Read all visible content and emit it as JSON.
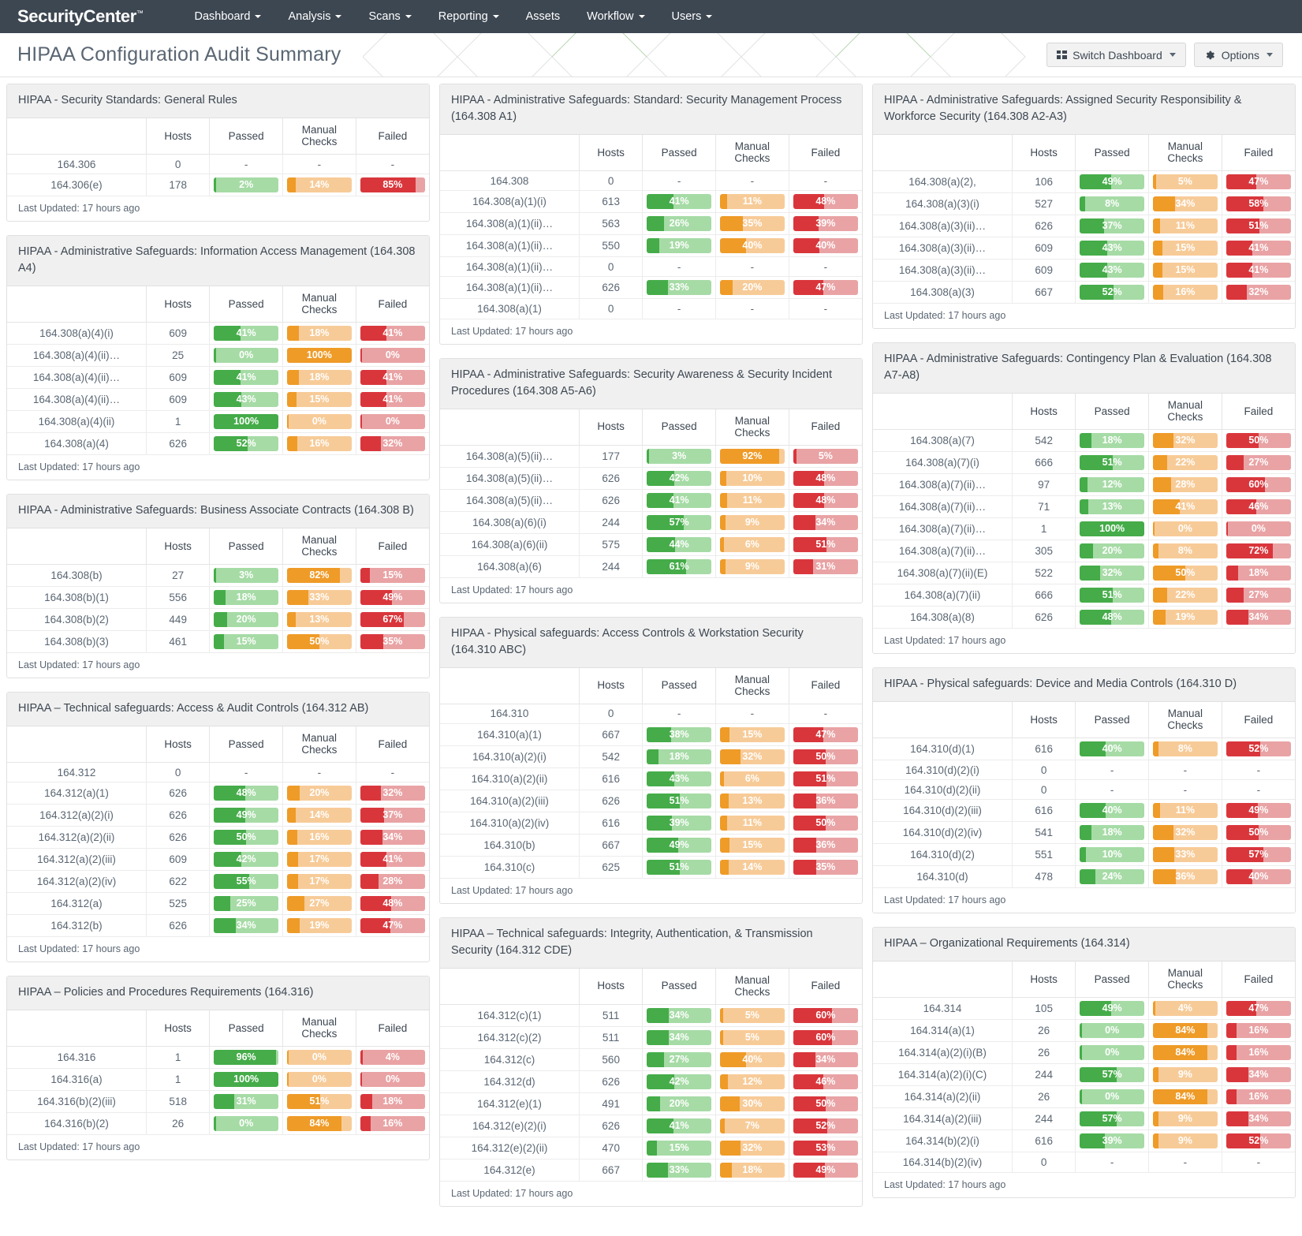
{
  "nav": {
    "brand": "SecurityCenter",
    "brand_tm": "™",
    "items": [
      {
        "label": "Dashboard",
        "caret": true
      },
      {
        "label": "Analysis",
        "caret": true
      },
      {
        "label": "Scans",
        "caret": true
      },
      {
        "label": "Reporting",
        "caret": true
      },
      {
        "label": "Assets",
        "caret": false
      },
      {
        "label": "Workflow",
        "caret": true
      },
      {
        "label": "Users",
        "caret": true
      }
    ]
  },
  "header": {
    "title": "HIPAA Configuration Audit Summary",
    "switch_dashboard": "Switch Dashboard",
    "options": "Options"
  },
  "colors": {
    "pass_fill": "#45ac49",
    "pass_track": "#a6dba6",
    "manual_fill": "#ef9b28",
    "manual_track": "#f7cb98",
    "fail_fill": "#d9363c",
    "fail_track": "#e9a3a5",
    "navbar": "#3d4752",
    "panel_head": "#f0f0f0"
  },
  "table_headers": [
    "",
    "Hosts",
    "Passed",
    "Manual Checks",
    "Failed"
  ],
  "last_updated": "Last Updated: 17 hours ago",
  "dash": "-",
  "columns": [
    {
      "panels": [
        {
          "title": "HIPAA - Security Standards: General Rules",
          "rows": [
            {
              "name": "164.306",
              "hosts": "0",
              "passed": null,
              "manual": null,
              "failed": null
            },
            {
              "name": "164.306(e)",
              "hosts": "178",
              "passed": "2%",
              "manual": "14%",
              "failed": "85%"
            }
          ]
        },
        {
          "title": "HIPAA - Administrative Safeguards: Information Access Management (164.308 A4)",
          "rows": [
            {
              "name": "164.308(a)(4)(i)",
              "hosts": "609",
              "passed": "41%",
              "manual": "18%",
              "failed": "41%"
            },
            {
              "name": "164.308(a)(4)(ii)…",
              "hosts": "25",
              "passed": "0%",
              "manual": "100%",
              "failed": "0%"
            },
            {
              "name": "164.308(a)(4)(ii)…",
              "hosts": "609",
              "passed": "41%",
              "manual": "18%",
              "failed": "41%"
            },
            {
              "name": "164.308(a)(4)(ii)…",
              "hosts": "609",
              "passed": "43%",
              "manual": "15%",
              "failed": "41%"
            },
            {
              "name": "164.308(a)(4)(ii)",
              "hosts": "1",
              "passed": "100%",
              "manual": "0%",
              "failed": "0%"
            },
            {
              "name": "164.308(a)(4)",
              "hosts": "626",
              "passed": "52%",
              "manual": "16%",
              "failed": "32%"
            }
          ]
        },
        {
          "title": "HIPAA - Administrative Safeguards: Business Associate Contracts (164.308 B)",
          "rows": [
            {
              "name": "164.308(b)",
              "hosts": "27",
              "passed": "3%",
              "manual": "82%",
              "failed": "15%"
            },
            {
              "name": "164.308(b)(1)",
              "hosts": "556",
              "passed": "18%",
              "manual": "33%",
              "failed": "49%"
            },
            {
              "name": "164.308(b)(2)",
              "hosts": "449",
              "passed": "20%",
              "manual": "13%",
              "failed": "67%"
            },
            {
              "name": "164.308(b)(3)",
              "hosts": "461",
              "passed": "15%",
              "manual": "50%",
              "failed": "35%"
            }
          ]
        },
        {
          "title": "HIPAA – Technical safeguards: Access & Audit Controls (164.312 AB)",
          "rows": [
            {
              "name": "164.312",
              "hosts": "0",
              "passed": null,
              "manual": null,
              "failed": null
            },
            {
              "name": "164.312(a)(1)",
              "hosts": "626",
              "passed": "48%",
              "manual": "20%",
              "failed": "32%"
            },
            {
              "name": "164.312(a)(2)(i)",
              "hosts": "626",
              "passed": "49%",
              "manual": "14%",
              "failed": "37%"
            },
            {
              "name": "164.312(a)(2)(ii)",
              "hosts": "626",
              "passed": "50%",
              "manual": "16%",
              "failed": "34%"
            },
            {
              "name": "164.312(a)(2)(iii)",
              "hosts": "609",
              "passed": "42%",
              "manual": "17%",
              "failed": "41%"
            },
            {
              "name": "164.312(a)(2)(iv)",
              "hosts": "622",
              "passed": "55%",
              "manual": "17%",
              "failed": "28%"
            },
            {
              "name": "164.312(a)",
              "hosts": "525",
              "passed": "25%",
              "manual": "27%",
              "failed": "48%"
            },
            {
              "name": "164.312(b)",
              "hosts": "626",
              "passed": "34%",
              "manual": "19%",
              "failed": "47%"
            }
          ]
        },
        {
          "title": "HIPAA – Policies and Procedures Requirements (164.316)",
          "rows": [
            {
              "name": "164.316",
              "hosts": "1",
              "passed": "96%",
              "manual": "0%",
              "failed": "4%"
            },
            {
              "name": "164.316(a)",
              "hosts": "1",
              "passed": "100%",
              "manual": "0%",
              "failed": "0%"
            },
            {
              "name": "164.316(b)(2)(iii)",
              "hosts": "518",
              "passed": "31%",
              "manual": "51%",
              "failed": "18%"
            },
            {
              "name": "164.316(b)(2)",
              "hosts": "26",
              "passed": "0%",
              "manual": "84%",
              "failed": "16%"
            }
          ]
        }
      ]
    },
    {
      "panels": [
        {
          "title": "HIPAA - Administrative Safeguards: Standard: Security Management Process (164.308 A1)",
          "rows": [
            {
              "name": "164.308",
              "hosts": "0",
              "passed": null,
              "manual": null,
              "failed": null
            },
            {
              "name": "164.308(a)(1)(i)",
              "hosts": "613",
              "passed": "41%",
              "manual": "11%",
              "failed": "48%"
            },
            {
              "name": "164.308(a)(1)(ii)…",
              "hosts": "563",
              "passed": "26%",
              "manual": "35%",
              "failed": "39%"
            },
            {
              "name": "164.308(a)(1)(ii)…",
              "hosts": "550",
              "passed": "19%",
              "manual": "40%",
              "failed": "40%"
            },
            {
              "name": "164.308(a)(1)(ii)…",
              "hosts": "0",
              "passed": null,
              "manual": null,
              "failed": null
            },
            {
              "name": "164.308(a)(1)(ii)…",
              "hosts": "626",
              "passed": "33%",
              "manual": "20%",
              "failed": "47%"
            },
            {
              "name": "164.308(a)(1)",
              "hosts": "0",
              "passed": null,
              "manual": null,
              "failed": null
            }
          ]
        },
        {
          "title": "HIPAA - Administrative Safeguards: Security Awareness & Security Incident Procedures (164.308 A5-A6)",
          "rows": [
            {
              "name": "164.308(a)(5)(ii)…",
              "hosts": "177",
              "passed": "3%",
              "manual": "92%",
              "failed": "5%"
            },
            {
              "name": "164.308(a)(5)(ii)…",
              "hosts": "626",
              "passed": "42%",
              "manual": "10%",
              "failed": "48%"
            },
            {
              "name": "164.308(a)(5)(ii)…",
              "hosts": "626",
              "passed": "41%",
              "manual": "11%",
              "failed": "48%"
            },
            {
              "name": "164.308(a)(6)(i)",
              "hosts": "244",
              "passed": "57%",
              "manual": "9%",
              "failed": "34%"
            },
            {
              "name": "164.308(a)(6)(ii)",
              "hosts": "575",
              "passed": "44%",
              "manual": "6%",
              "failed": "51%"
            },
            {
              "name": "164.308(a)(6)",
              "hosts": "244",
              "passed": "61%",
              "manual": "9%",
              "failed": "31%"
            }
          ]
        },
        {
          "title": "HIPAA - Physical safeguards: Access Controls & Workstation Security (164.310 ABC)",
          "rows": [
            {
              "name": "164.310",
              "hosts": "0",
              "passed": null,
              "manual": null,
              "failed": null
            },
            {
              "name": "164.310(a)(1)",
              "hosts": "667",
              "passed": "38%",
              "manual": "15%",
              "failed": "47%"
            },
            {
              "name": "164.310(a)(2)(i)",
              "hosts": "542",
              "passed": "18%",
              "manual": "32%",
              "failed": "50%"
            },
            {
              "name": "164.310(a)(2)(ii)",
              "hosts": "616",
              "passed": "43%",
              "manual": "6%",
              "failed": "51%"
            },
            {
              "name": "164.310(a)(2)(iii)",
              "hosts": "626",
              "passed": "51%",
              "manual": "13%",
              "failed": "36%"
            },
            {
              "name": "164.310(a)(2)(iv)",
              "hosts": "616",
              "passed": "39%",
              "manual": "11%",
              "failed": "50%"
            },
            {
              "name": "164.310(b)",
              "hosts": "667",
              "passed": "49%",
              "manual": "15%",
              "failed": "36%"
            },
            {
              "name": "164.310(c)",
              "hosts": "625",
              "passed": "51%",
              "manual": "14%",
              "failed": "35%"
            }
          ]
        },
        {
          "title": "HIPAA – Technical safeguards: Integrity, Authentication, & Transmission Security (164.312 CDE)",
          "rows": [
            {
              "name": "164.312(c)(1)",
              "hosts": "511",
              "passed": "34%",
              "manual": "5%",
              "failed": "60%"
            },
            {
              "name": "164.312(c)(2)",
              "hosts": "511",
              "passed": "34%",
              "manual": "5%",
              "failed": "60%"
            },
            {
              "name": "164.312(c)",
              "hosts": "560",
              "passed": "27%",
              "manual": "40%",
              "failed": "34%"
            },
            {
              "name": "164.312(d)",
              "hosts": "626",
              "passed": "42%",
              "manual": "12%",
              "failed": "46%"
            },
            {
              "name": "164.312(e)(1)",
              "hosts": "491",
              "passed": "20%",
              "manual": "30%",
              "failed": "50%"
            },
            {
              "name": "164.312(e)(2)(i)",
              "hosts": "626",
              "passed": "41%",
              "manual": "7%",
              "failed": "52%"
            },
            {
              "name": "164.312(e)(2)(ii)",
              "hosts": "470",
              "passed": "15%",
              "manual": "32%",
              "failed": "53%"
            },
            {
              "name": "164.312(e)",
              "hosts": "667",
              "passed": "33%",
              "manual": "18%",
              "failed": "49%"
            }
          ]
        }
      ]
    },
    {
      "panels": [
        {
          "title": "HIPAA - Administrative Safeguards: Assigned Security Responsibility & Workforce Security (164.308 A2-A3)",
          "rows": [
            {
              "name": "164.308(a)(2),",
              "hosts": "106",
              "passed": "49%",
              "manual": "5%",
              "failed": "47%"
            },
            {
              "name": "164.308(a)(3)(i)",
              "hosts": "527",
              "passed": "8%",
              "manual": "34%",
              "failed": "58%"
            },
            {
              "name": "164.308(a)(3)(ii)…",
              "hosts": "626",
              "passed": "37%",
              "manual": "11%",
              "failed": "51%"
            },
            {
              "name": "164.308(a)(3)(ii)…",
              "hosts": "609",
              "passed": "43%",
              "manual": "15%",
              "failed": "41%"
            },
            {
              "name": "164.308(a)(3)(ii)…",
              "hosts": "609",
              "passed": "43%",
              "manual": "15%",
              "failed": "41%"
            },
            {
              "name": "164.308(a)(3)",
              "hosts": "667",
              "passed": "52%",
              "manual": "16%",
              "failed": "32%"
            }
          ]
        },
        {
          "title": "HIPAA - Administrative Safeguards: Contingency Plan & Evaluation (164.308 A7-A8)",
          "rows": [
            {
              "name": "164.308(a)(7)",
              "hosts": "542",
              "passed": "18%",
              "manual": "32%",
              "failed": "50%"
            },
            {
              "name": "164.308(a)(7)(i)",
              "hosts": "666",
              "passed": "51%",
              "manual": "22%",
              "failed": "27%"
            },
            {
              "name": "164.308(a)(7)(ii)…",
              "hosts": "97",
              "passed": "12%",
              "manual": "28%",
              "failed": "60%"
            },
            {
              "name": "164.308(a)(7)(ii)…",
              "hosts": "71",
              "passed": "13%",
              "manual": "41%",
              "failed": "46%"
            },
            {
              "name": "164.308(a)(7)(ii)…",
              "hosts": "1",
              "passed": "100%",
              "manual": "0%",
              "failed": "0%"
            },
            {
              "name": "164.308(a)(7)(ii)…",
              "hosts": "305",
              "passed": "20%",
              "manual": "8%",
              "failed": "72%"
            },
            {
              "name": "164.308(a)(7)(ii)(E)",
              "hosts": "522",
              "passed": "32%",
              "manual": "50%",
              "failed": "18%"
            },
            {
              "name": "164.308(a)(7)(ii)",
              "hosts": "666",
              "passed": "51%",
              "manual": "22%",
              "failed": "27%"
            },
            {
              "name": "164.308(a)(8)",
              "hosts": "626",
              "passed": "48%",
              "manual": "19%",
              "failed": "34%"
            }
          ]
        },
        {
          "title": "HIPAA - Physical safeguards: Device and Media Controls (164.310 D)",
          "rows": [
            {
              "name": "164.310(d)(1)",
              "hosts": "616",
              "passed": "40%",
              "manual": "8%",
              "failed": "52%"
            },
            {
              "name": "164.310(d)(2)(i)",
              "hosts": "0",
              "passed": null,
              "manual": null,
              "failed": null
            },
            {
              "name": "164.310(d)(2)(ii)",
              "hosts": "0",
              "passed": null,
              "manual": null,
              "failed": null
            },
            {
              "name": "164.310(d)(2)(iii)",
              "hosts": "616",
              "passed": "40%",
              "manual": "11%",
              "failed": "49%"
            },
            {
              "name": "164.310(d)(2)(iv)",
              "hosts": "541",
              "passed": "18%",
              "manual": "32%",
              "failed": "50%"
            },
            {
              "name": "164.310(d)(2)",
              "hosts": "551",
              "passed": "10%",
              "manual": "33%",
              "failed": "57%"
            },
            {
              "name": "164.310(d)",
              "hosts": "478",
              "passed": "24%",
              "manual": "36%",
              "failed": "40%"
            }
          ]
        },
        {
          "title": "HIPAA – Organizational Requirements (164.314)",
          "rows": [
            {
              "name": "164.314",
              "hosts": "105",
              "passed": "49%",
              "manual": "4%",
              "failed": "47%"
            },
            {
              "name": "164.314(a)(1)",
              "hosts": "26",
              "passed": "0%",
              "manual": "84%",
              "failed": "16%"
            },
            {
              "name": "164.314(a)(2)(i)(B)",
              "hosts": "26",
              "passed": "0%",
              "manual": "84%",
              "failed": "16%"
            },
            {
              "name": "164.314(a)(2)(i)(C)",
              "hosts": "244",
              "passed": "57%",
              "manual": "9%",
              "failed": "34%"
            },
            {
              "name": "164.314(a)(2)(ii)",
              "hosts": "26",
              "passed": "0%",
              "manual": "84%",
              "failed": "16%"
            },
            {
              "name": "164.314(a)(2)(iii)",
              "hosts": "244",
              "passed": "57%",
              "manual": "9%",
              "failed": "34%"
            },
            {
              "name": "164.314(b)(2)(i)",
              "hosts": "616",
              "passed": "39%",
              "manual": "9%",
              "failed": "52%"
            },
            {
              "name": "164.314(b)(2)(iv)",
              "hosts": "0",
              "passed": null,
              "manual": null,
              "failed": null
            }
          ]
        }
      ]
    }
  ]
}
